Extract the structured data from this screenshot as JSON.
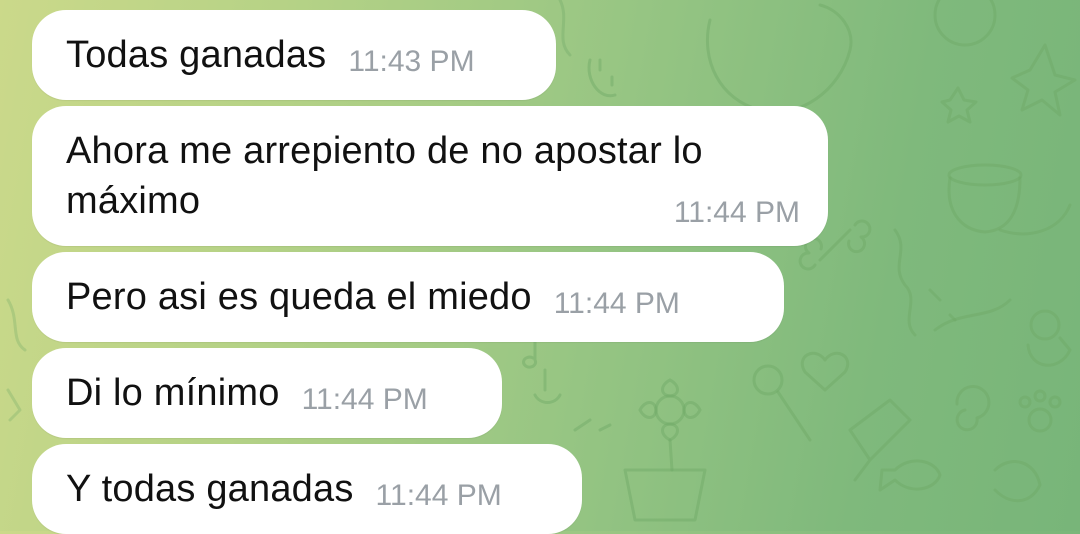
{
  "chat": {
    "messages": [
      {
        "text": "Todas ganadas",
        "time": "11:43 PM"
      },
      {
        "text_line1": "Ahora me arrepiento de no apostar lo",
        "text_line2": "máximo",
        "time": "11:44 PM"
      },
      {
        "text": "Pero asi es queda el miedo",
        "time": "11:44 PM"
      },
      {
        "text": "Di lo mínimo",
        "time": "11:44 PM"
      },
      {
        "text": "Y todas ganadas",
        "time": "11:44 PM"
      }
    ]
  },
  "colors": {
    "bubble": "#ffffff",
    "timestamp": "#9aa0a6",
    "wallpaper_left": "#cbd98a",
    "wallpaper_right": "#78b579"
  }
}
